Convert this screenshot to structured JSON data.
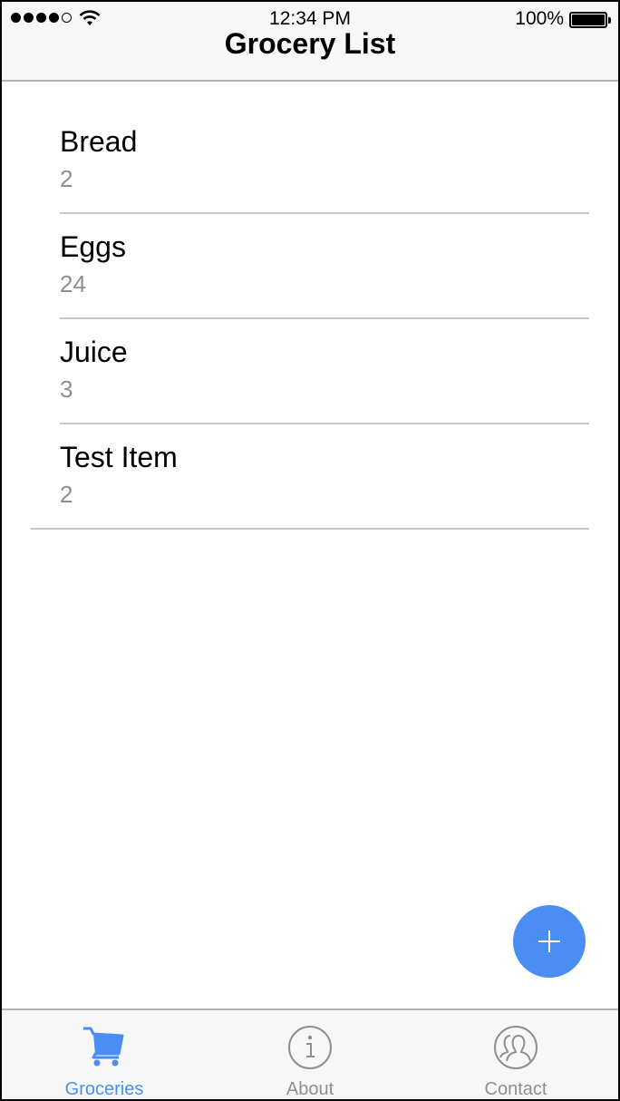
{
  "status_bar": {
    "time": "12:34 PM",
    "battery": "100%"
  },
  "header": {
    "title": "Grocery List"
  },
  "items": [
    {
      "name": "Bread",
      "quantity": "2"
    },
    {
      "name": "Eggs",
      "quantity": "24"
    },
    {
      "name": "Juice",
      "quantity": "3"
    },
    {
      "name": "Test Item",
      "quantity": "2"
    }
  ],
  "fab": {
    "icon": "plus-icon"
  },
  "tabs": [
    {
      "label": "Groceries",
      "icon": "cart-icon",
      "active": true
    },
    {
      "label": "About",
      "icon": "info-icon",
      "active": false
    },
    {
      "label": "Contact",
      "icon": "contacts-icon",
      "active": false
    }
  ],
  "colors": {
    "accent": "#4a8ef4",
    "secondary_text": "#8e8e93",
    "separator": "#c8c7cc",
    "bar_background": "#f7f7f7"
  }
}
